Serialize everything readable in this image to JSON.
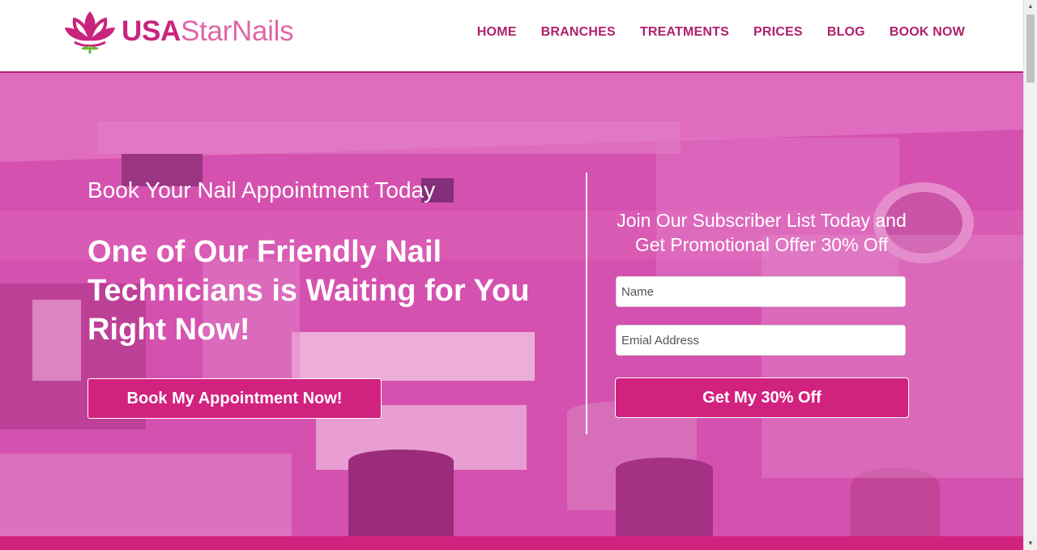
{
  "brand": {
    "logo_bold": "USA",
    "logo_rest": "StarNails",
    "color_primary": "#d2227f",
    "color_nav": "#b0206c"
  },
  "nav": {
    "items": [
      {
        "label": "HOME"
      },
      {
        "label": "BRANCHES"
      },
      {
        "label": "TREATMENTS"
      },
      {
        "label": "PRICES"
      },
      {
        "label": "BLOG"
      },
      {
        "label": "BOOK NOW"
      }
    ]
  },
  "hero": {
    "subtitle": "Book Your Nail Appointment Today",
    "headline": "One of Our Friendly Nail Technicians is Waiting for You Right Now!",
    "cta_label": "Book My Appointment Now!"
  },
  "subscribe": {
    "title": "Join Our Subscriber List Today and Get Promotional Offer 30% Off",
    "name_placeholder": "Name",
    "email_placeholder": "Emial Address",
    "submit_label": "Get My 30% Off"
  },
  "icons": {
    "logo": "lotus-icon",
    "scroll_up": "arrow-up-icon",
    "scroll_down": "arrow-down-icon"
  }
}
